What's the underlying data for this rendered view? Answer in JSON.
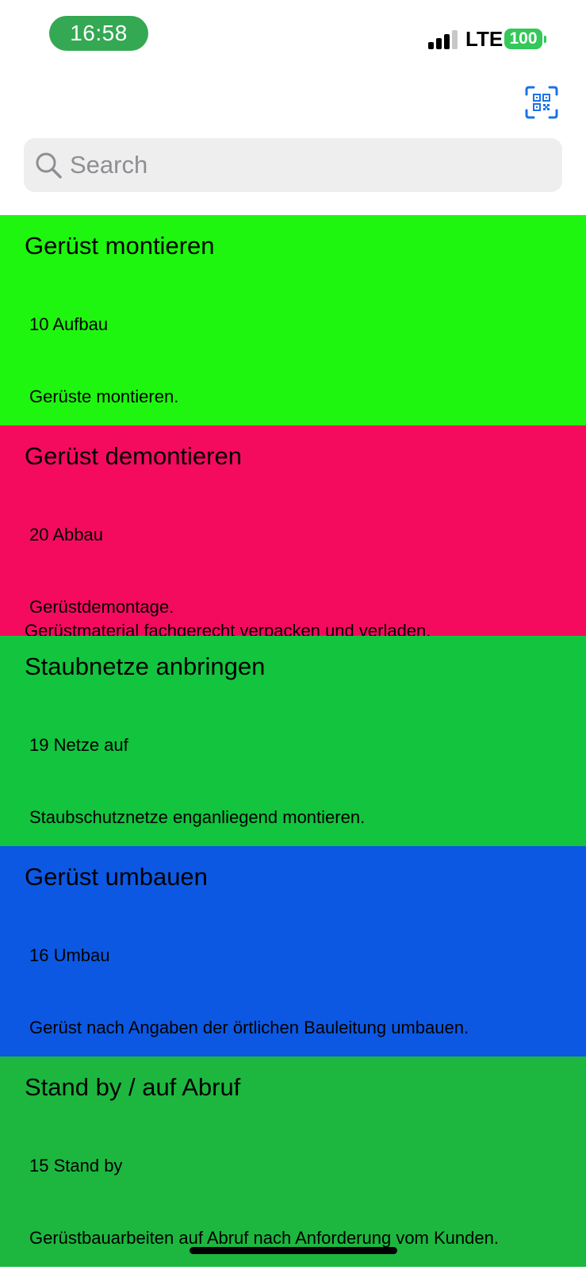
{
  "status_bar": {
    "time": "16:58",
    "network": "LTE",
    "battery": "100",
    "signal_icon": "cellular-signal-icon"
  },
  "header": {
    "qr_icon": "qr-code-scan-icon"
  },
  "search": {
    "placeholder": "Search",
    "value": ""
  },
  "items": [
    {
      "title": "Gerüst montieren",
      "code": "10 Aufbau",
      "description": [
        "Gerüste montieren."
      ],
      "color": "#1ef60f"
    },
    {
      "title": "Gerüst demontieren",
      "code": "20 Abbau",
      "description": [
        "Gerüstdemontage.",
        "Gerüstmaterial fachgerecht verpacken und verladen."
      ],
      "color": "#f40b5e"
    },
    {
      "title": "Staubnetze anbringen",
      "code": "19 Netze auf",
      "description": [
        "Staubschutznetze enganliegend montieren."
      ],
      "color": "#13c43f"
    },
    {
      "title": "Gerüst umbauen",
      "code": "16 Umbau",
      "description": [
        "Gerüst nach Angaben der örtlichen Bauleitung umbauen."
      ],
      "color": "#0c58e3"
    },
    {
      "title": "Stand by / auf Abruf",
      "code": "15 Stand by",
      "description": [
        "Gerüstbauarbeiten auf Abruf nach Anforderung vom Kunden."
      ],
      "color": "#1db73f"
    }
  ],
  "colors": {
    "time_pill": "#34a853",
    "battery": "#34c759",
    "accent": "#1a73e8"
  }
}
